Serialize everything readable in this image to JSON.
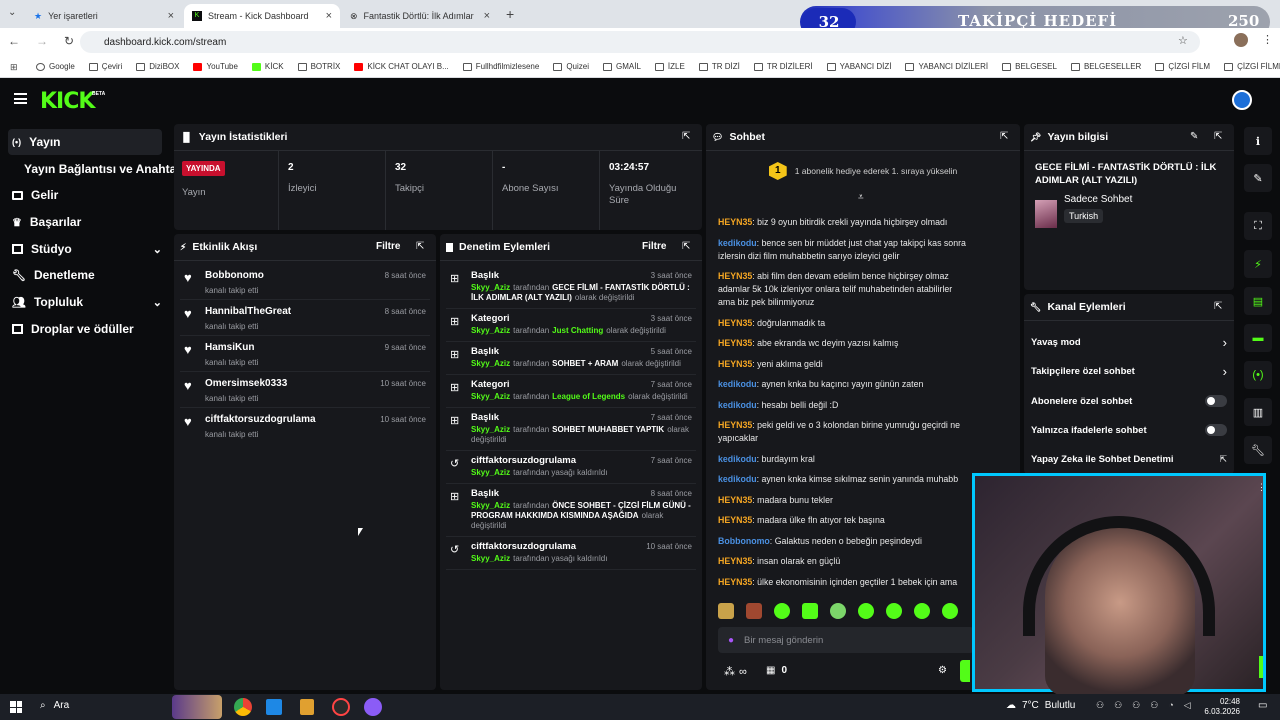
{
  "browser": {
    "tabs": [
      {
        "label": "Yer işaretleri"
      },
      {
        "label": "Stream - Kick Dashboard"
      },
      {
        "label": "Fantastik Dörtlü: İlk Adımlar Fil"
      }
    ],
    "url": "dashboard.kick.com/stream",
    "bookmarks": [
      "Google",
      "Çeviri",
      "DiziBOX",
      "YouTube",
      "KİCK",
      "BOTRİX",
      "KİCK CHAT OLAYI B...",
      "Fullhdfilmizlesene",
      "Quizei",
      "GMAİL",
      "İZLE",
      "TR DİZİ",
      "TR DİZİLERİ",
      "YABANCI DİZİ",
      "YABANCI DİZİLERİ",
      "BELGESEL",
      "BELGESELLER",
      "ÇİZGİ FİLM",
      "ÇİZGİ FİLMLER"
    ]
  },
  "overlay": {
    "count": "32",
    "label": "TAKİPÇİ HEDEFİ",
    "goal": "250"
  },
  "kick": {
    "logo": "KICK",
    "beta": "BETA"
  },
  "sidebar": [
    {
      "label": "Yayın",
      "icon": "broadcast-icon"
    },
    {
      "label": "Yayın Bağlantısı ve Anahtarı",
      "icon": ""
    },
    {
      "label": "Gelir",
      "icon": "revenue-icon"
    },
    {
      "label": "Başarılar",
      "icon": "trophy-icon"
    },
    {
      "label": "Stüdyo",
      "icon": "studio-icon"
    },
    {
      "label": "Denetleme",
      "icon": "wrench-icon"
    },
    {
      "label": "Topluluk",
      "icon": "community-icon"
    },
    {
      "label": "Droplar ve ödüller",
      "icon": "gift-icon"
    }
  ],
  "stats": {
    "title": "Yayın İstatistikleri",
    "live_badge": "YAYINDA",
    "items": [
      {
        "value": "",
        "label": "Yayın"
      },
      {
        "value": "2",
        "label": "İzleyici"
      },
      {
        "value": "32",
        "label": "Takipçi"
      },
      {
        "value": "-",
        "label": "Abone Sayısı"
      },
      {
        "value": "03:24:57",
        "label": "Yayında Olduğu Süre"
      }
    ]
  },
  "activity": {
    "title": "Etkinlik Akışı",
    "filter": "Filtre",
    "items": [
      {
        "name": "Bobbonomo",
        "sub": "kanalı takip etti",
        "time": "8 saat önce"
      },
      {
        "name": "HannibalTheGreat",
        "sub": "kanalı takip etti",
        "time": "8 saat önce"
      },
      {
        "name": "HamsiKun",
        "sub": "kanalı takip etti",
        "time": "9 saat önce"
      },
      {
        "name": "Omersimsek0333",
        "sub": "kanalı takip etti",
        "time": "10 saat önce"
      },
      {
        "name": "ciftfaktorsuzdogrulama",
        "sub": "kanalı takip etti",
        "time": "10 saat önce"
      }
    ]
  },
  "moderation": {
    "title": "Denetim Eylemleri",
    "filter": "Filtre",
    "items": [
      {
        "title": "Başlık",
        "time": "3 saat önce",
        "user": "Skyy_Aziz",
        "by": "tarafından",
        "value": "GECE FİLMİ - FANTASTİK DÖRTLÜ : İLK ADIMLAR (ALT YAZILI)",
        "suffix": "olarak değiştirildi"
      },
      {
        "title": "Kategori",
        "time": "3 saat önce",
        "user": "Skyy_Aziz",
        "by": "tarafından",
        "value": "Just Chatting",
        "suffix": "olarak değiştirildi"
      },
      {
        "title": "Başlık",
        "time": "5 saat önce",
        "user": "Skyy_Aziz",
        "by": "tarafından",
        "value": "SOHBET + ARAM",
        "suffix": "olarak değiştirildi"
      },
      {
        "title": "Kategori",
        "time": "7 saat önce",
        "user": "Skyy_Aziz",
        "by": "tarafından",
        "value": "League of Legends",
        "suffix": "olarak değiştirildi"
      },
      {
        "title": "Başlık",
        "time": "7 saat önce",
        "user": "Skyy_Aziz",
        "by": "tarafından",
        "value": "SOHBET MUHABBET YAPTIK",
        "suffix": "olarak değiştirildi"
      },
      {
        "title": "ciftfaktorsuzdogrulama",
        "time": "7 saat önce",
        "user": "Skyy_Aziz",
        "by": "tarafından yasağı kaldırıldı",
        "value": "",
        "suffix": ""
      },
      {
        "title": "Başlık",
        "time": "8 saat önce",
        "user": "Skyy_Aziz",
        "by": "tarafından",
        "value": "ÖNCE SOHBET - ÇİZGİ FİLM GÜNÜ - PROGRAM HAKKIMDA KISMINDA AŞAĞIDA",
        "suffix": "olarak değiştirildi"
      },
      {
        "title": "ciftfaktorsuzdogrulama",
        "time": "10 saat önce",
        "user": "Skyy_Aziz",
        "by": "tarafından yasağı kaldırıldı",
        "value": "",
        "suffix": ""
      }
    ]
  },
  "chat": {
    "title": "Sohbet",
    "gift_text": "1 abonelik hediye ederek 1. sıraya yükselin",
    "gift_rank": "1",
    "messages": [
      {
        "user": "HEYN35",
        "color": "#f5a623",
        "text": "biz 9 oyun bitirdik crekli yayında hiçbirşey olmadı"
      },
      {
        "user": "kedikodu",
        "color": "#4a90e2",
        "text": "bence sen bir müddet just chat yap takipçi kas sonra izlersin dizi film muhabbetin sarıyo izleyici gelir"
      },
      {
        "user": "HEYN35",
        "color": "#f5a623",
        "text": "abi film den devam edelim bence hiçbirşey olmaz adamlar 5k 10k izleniyor onlara telif muhabetinden atabilirler ama biz pek bilinmiyoruz"
      },
      {
        "user": "HEYN35",
        "color": "#f5a623",
        "text": "doğrulanmadık ta"
      },
      {
        "user": "HEYN35",
        "color": "#f5a623",
        "text": "abe ekranda wc deyim yazısı kalmış"
      },
      {
        "user": "HEYN35",
        "color": "#f5a623",
        "text": "yeni aklıma geldi"
      },
      {
        "user": "kedikodu",
        "color": "#4a90e2",
        "text": "aynen knka bu kaçıncı yayın günün zaten"
      },
      {
        "user": "kedikodu",
        "color": "#4a90e2",
        "text": "hesabı belli değil :D"
      },
      {
        "user": "HEYN35",
        "color": "#f5a623",
        "text": "peki geldi ve o 3 kolondan birine yumruğu geçirdi ne yapıcaklar"
      },
      {
        "user": "kedikodu",
        "color": "#4a90e2",
        "text": "burdayım kral"
      },
      {
        "user": "kedikodu",
        "color": "#4a90e2",
        "text": "aynen knka kimse sıkılmaz senin yanında muhabb"
      },
      {
        "user": "HEYN35",
        "color": "#f5a623",
        "text": "madara bunu tekler"
      },
      {
        "user": "HEYN35",
        "color": "#f5a623",
        "text": "madara ülke fln atıyor tek başına"
      },
      {
        "user": "Bobbonomo",
        "color": "#4a90e2",
        "text": "Galaktus neden o bebeğin peşindeydi"
      },
      {
        "user": "HEYN35",
        "color": "#f5a623",
        "text": "insan olarak en güçlü"
      },
      {
        "user": "HEYN35",
        "color": "#f5a623",
        "text": "ülke ekonomisinin içinden geçtiler 1 bebek için ama"
      }
    ],
    "placeholder": "Bir mesaj gönderin",
    "infinity": "∞",
    "count": "0"
  },
  "stream_info": {
    "title": "Yayın bilgisi",
    "stream_title": "GECE FİLMİ - FANTASTİK DÖRTLÜ : İLK ADIMLAR (ALT YAZILI)",
    "category": "Sadece Sohbet",
    "tag": "Turkish"
  },
  "channel_actions": {
    "title": "Kanal Eylemleri",
    "items": [
      {
        "label": "Yavaş mod",
        "type": "chevron"
      },
      {
        "label": "Takipçilere özel sohbet",
        "type": "chevron"
      },
      {
        "label": "Abonelere özel sohbet",
        "type": "toggle"
      },
      {
        "label": "Yalnızca ifadelerle sohbet",
        "type": "toggle"
      },
      {
        "label": "Yapay Zeka ile Sohbet Denetimi",
        "type": "link"
      }
    ]
  },
  "taskbar": {
    "search": "Ara",
    "weather": "7°C",
    "weather_label": "Bulutlu",
    "time": "02:48",
    "date": "6.03.2026"
  }
}
